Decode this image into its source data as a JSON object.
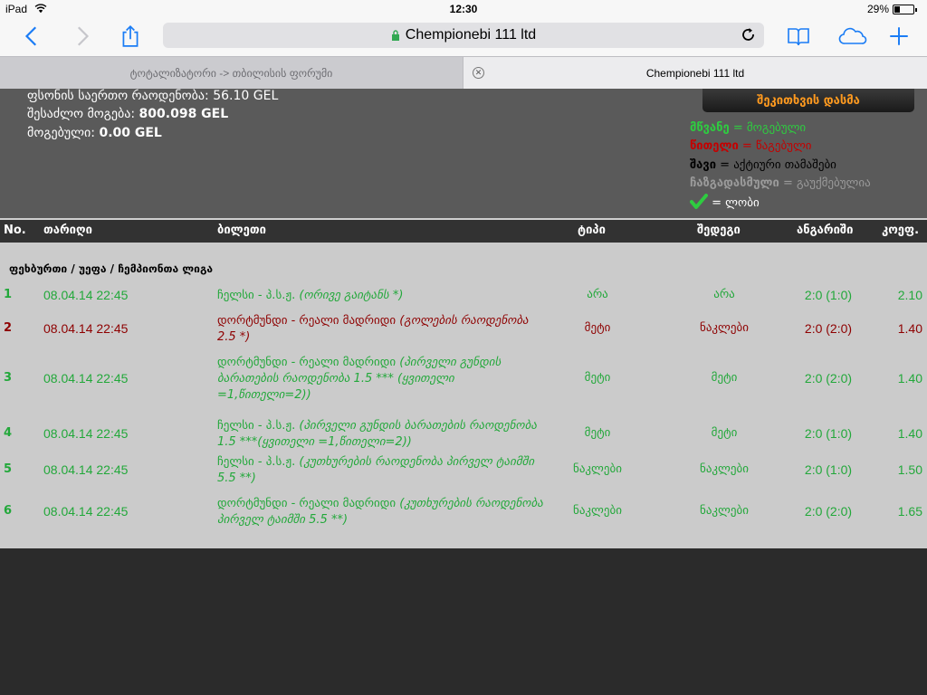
{
  "status_bar": {
    "carrier": "iPad",
    "time": "12:30",
    "battery_pct": "29%",
    "battery_level": 0.29
  },
  "browser": {
    "url": "Chempionebi 111 ltd",
    "tabs": [
      {
        "label": "ტოტალიზატორი -> თბილისის ფორუმი",
        "active": false
      },
      {
        "label": "Chempionebi 111 ltd",
        "active": true
      }
    ]
  },
  "summary": {
    "total_bet_label": "ფსონის საერთო რაოდენობა:",
    "total_bet_value": "56.10 GEL",
    "possible_win_label": "შესაძლო მოგება:",
    "possible_win_value": "800.098 GEL",
    "won_label": "მოგებული:",
    "won_value": "0.00 GEL",
    "check_button": "შეკითხვის დასმა"
  },
  "legend": {
    "green_word": "მწვანე",
    "green_text": " = მოგებული",
    "red_word": "წითელი",
    "red_text": " = წაგებული",
    "black_word": "შავი",
    "black_text": " = აქტიური თამაშები",
    "grey_word": "ჩაზგადასმული",
    "grey_text": " = გაუქმებულია",
    "check_text": " = ლობი"
  },
  "table": {
    "headers": {
      "no": "No.",
      "date": "თარიღი",
      "bet": "ბილეთი",
      "type": "ტიპი",
      "result": "შედეგი",
      "score": "ანგარიში",
      "coef": "კოეფ."
    },
    "league": "ფეხბურთი / უეფა / ჩემპიონთა ლიგა",
    "rows": [
      {
        "no": "1",
        "date": "08.04.14 22:45",
        "match": "ჩელსი - პ.ს.ჟ.",
        "detail": "(ორივე გაიტანს *)",
        "type": "არა",
        "result": "არა",
        "score": "2:0 (1:0)",
        "coef": "2.10",
        "status": "green"
      },
      {
        "no": "2",
        "date": "08.04.14 22:45",
        "match": "დორტმუნდი - რეალი მადრიდი",
        "detail": "(გოლების რაოდენობა 2.5 *)",
        "type": "მეტი",
        "result": "ნაკლები",
        "score": "2:0 (2:0)",
        "coef": "1.40",
        "status": "red"
      },
      {
        "no": "3",
        "date": "08.04.14 22:45",
        "match": "დორტმუნდი - რეალი მადრიდი",
        "detail": "(პირველი გუნდის ბარათების რაოდენობა 1.5 *** (ყვითელი =1,წითელი=2))",
        "type": "მეტი",
        "result": "მეტი",
        "score": "2:0 (2:0)",
        "coef": "1.40",
        "status": "green"
      },
      {
        "no": "4",
        "date": "08.04.14 22:45",
        "match": "ჩელსი - პ.ს.ჟ.",
        "detail": "(პირველი გუნდის ბარათების რაოდენობა 1.5 ***(ყვითელი =1,წითელი=2))",
        "type": "მეტი",
        "result": "მეტი",
        "score": "2:0 (1:0)",
        "coef": "1.40",
        "status": "green"
      },
      {
        "no": "5",
        "date": "08.04.14 22:45",
        "match": "ჩელსი - პ.ს.ჟ.",
        "detail": "(კუთხურების რაოდენობა პირველ ტაიმში 5.5 **)",
        "type": "ნაკლები",
        "result": "ნაკლები",
        "score": "2:0 (1:0)",
        "coef": "1.50",
        "status": "green"
      },
      {
        "no": "6",
        "date": "08.04.14 22:45",
        "match": "დორტმუნდი - რეალი მადრიდი",
        "detail": "(კუთხურების რაოდენობა პირველ ტაიმში 5.5 **)",
        "type": "ნაკლები",
        "result": "ნაკლები",
        "score": "2:0 (2:0)",
        "coef": "1.65",
        "status": "green"
      }
    ]
  },
  "icons": {
    "wifi": "wifi-icon",
    "back": "back-chevron-icon",
    "forward": "forward-chevron-icon",
    "share": "share-icon",
    "lock": "lock-icon",
    "reload": "reload-icon",
    "bookmarks": "book-icon",
    "icloud": "cloud-icon",
    "new_tab": "plus-icon",
    "tab_close": "close-icon",
    "lobby": "checkmark-icon"
  },
  "colors": {
    "won": "#22a83a",
    "lost": "#8e0000",
    "button_text": "#ff9a1f",
    "ios_blue": "#1a7cf5"
  }
}
